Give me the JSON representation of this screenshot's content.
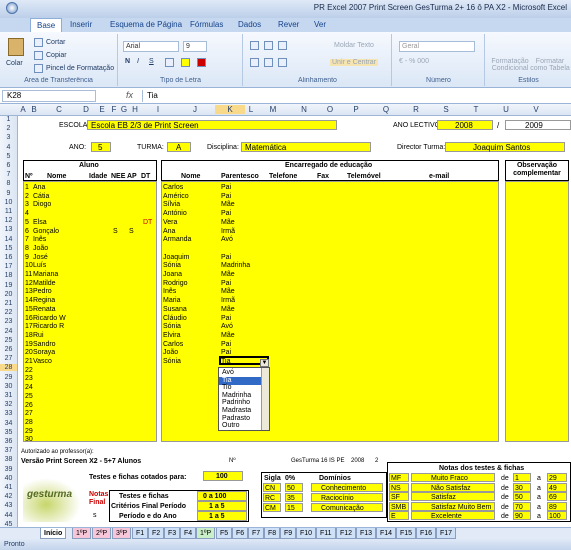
{
  "window": {
    "title": "PR Excel 2007 Print Screen GesTurma 2+ 16 ô PA X2 - Microsoft Excel"
  },
  "tabs": [
    "Base",
    "Inserir",
    "Esquema de Página",
    "Fórmulas",
    "Dados",
    "Rever",
    "Ver"
  ],
  "ribbon": {
    "paste": "Colar",
    "cut": "Cortar",
    "copy": "Copiar",
    "format_painter": "Pincel de Formatação",
    "clipboard_group": "Área de Transferência",
    "font_name": "Arial",
    "font_size": "9",
    "font_group": "Tipo de Letra",
    "wrap_text": "Moldar Texto",
    "merge_center": "Unir e Centrar",
    "alignment_group": "Alinhamento",
    "number_format": "Geral",
    "number_group": "Número",
    "conditional": "Formatação Condicional",
    "as_table": "Formatar como Tabela",
    "styles_group": "Estilos"
  },
  "formula_bar": {
    "cell": "K28",
    "fx": "fx",
    "value": "Tia"
  },
  "columns": [
    "A",
    "B",
    "C",
    "D",
    "E",
    "F",
    "G",
    "H",
    "I",
    "J",
    "K",
    "L",
    "M",
    "N",
    "O",
    "P",
    "Q",
    "R",
    "S",
    "T",
    "U",
    "V",
    "W",
    "X"
  ],
  "rows": [
    "1",
    "2",
    "3",
    "4",
    "5",
    "6",
    "7",
    "8",
    "9",
    "10",
    "11",
    "12",
    "13",
    "14",
    "15",
    "16",
    "17",
    "18",
    "19",
    "20",
    "21",
    "22",
    "23",
    "24",
    "25",
    "26",
    "27",
    "28",
    "29",
    "30",
    "31",
    "32",
    "33",
    "34",
    "35",
    "36",
    "37",
    "38",
    "39",
    "40",
    "41",
    "42",
    "43",
    "44",
    "45"
  ],
  "header": {
    "escola_label": "ESCOLA:",
    "escola_value": "Escola EB 2/3 de Print Screen",
    "ano_lectivo_label": "ANO LECTIVO:",
    "ano1": "2008",
    "slash": "/",
    "ano2": "2009",
    "ano_label": "ANO:",
    "ano_value": "5",
    "turma_label": "TURMA:",
    "turma_value": "A",
    "disciplina_label": "Disciplina:",
    "disciplina_value": "Matemática",
    "director_label": "Director Turma:",
    "director_value": "Joaquim Santos"
  },
  "table_headers": {
    "aluno": "Aluno",
    "enc": "Encarregado de educação",
    "obs": "Observação complementar",
    "n": "Nº",
    "nome": "Nome",
    "idade": "Idade",
    "nee": "NEE",
    "ap": "AP",
    "dt": "DT",
    "enc_nome": "Nome",
    "parentesco": "Parentesco",
    "telefone": "Telefone",
    "fax": "Fax",
    "telemovel": "Telemóvel",
    "email": "e-mail"
  },
  "students": [
    {
      "n": "1",
      "nome": "Ana",
      "nee": "",
      "ap": "",
      "dt": "",
      "enc": "Carlos",
      "par": "Pai"
    },
    {
      "n": "2",
      "nome": "Cátia",
      "nee": "",
      "ap": "",
      "dt": "",
      "enc": "Américo",
      "par": "Pai"
    },
    {
      "n": "3",
      "nome": "Diogo",
      "nee": "",
      "ap": "",
      "dt": "",
      "enc": "Sílvia",
      "par": "Mãe"
    },
    {
      "n": "4",
      "nome": "",
      "nee": "",
      "ap": "",
      "dt": "",
      "enc": "António",
      "par": "Pai"
    },
    {
      "n": "5",
      "nome": "Elsa",
      "nee": "",
      "ap": "",
      "dt": "DT",
      "enc": "Vera",
      "par": "Mãe"
    },
    {
      "n": "6",
      "nome": "Gonçalo",
      "nee": "S",
      "ap": "S",
      "dt": "",
      "enc": "Ana",
      "par": "Irmã"
    },
    {
      "n": "7",
      "nome": "Inês",
      "nee": "",
      "ap": "",
      "dt": "",
      "enc": "Armanda",
      "par": "Avó"
    },
    {
      "n": "8",
      "nome": "João",
      "nee": "",
      "ap": "",
      "dt": "",
      "enc": "",
      "par": ""
    },
    {
      "n": "9",
      "nome": "José",
      "nee": "",
      "ap": "",
      "dt": "",
      "enc": "Joaquim",
      "par": "Pai"
    },
    {
      "n": "10",
      "nome": "Luís",
      "nee": "",
      "ap": "",
      "dt": "",
      "enc": "Sónia",
      "par": "Madrinha"
    },
    {
      "n": "11",
      "nome": "Mariana",
      "nee": "",
      "ap": "",
      "dt": "",
      "enc": "Joana",
      "par": "Mãe"
    },
    {
      "n": "12",
      "nome": "Matilde",
      "nee": "",
      "ap": "",
      "dt": "",
      "enc": "Rodrigo",
      "par": "Pai"
    },
    {
      "n": "13",
      "nome": "Pedro",
      "nee": "",
      "ap": "",
      "dt": "",
      "enc": "Inês",
      "par": "Mãe"
    },
    {
      "n": "14",
      "nome": "Regina",
      "nee": "",
      "ap": "",
      "dt": "",
      "enc": "Maria",
      "par": "Irmã"
    },
    {
      "n": "15",
      "nome": "Renata",
      "nee": "",
      "ap": "",
      "dt": "",
      "enc": "Susana",
      "par": "Mãe"
    },
    {
      "n": "16",
      "nome": "Ricardo W",
      "nee": "",
      "ap": "",
      "dt": "",
      "enc": "Cláudio",
      "par": "Pai"
    },
    {
      "n": "17",
      "nome": "Ricardo R",
      "nee": "",
      "ap": "",
      "dt": "",
      "enc": "Sónia",
      "par": "Avó"
    },
    {
      "n": "18",
      "nome": "Rui",
      "nee": "",
      "ap": "",
      "dt": "",
      "enc": "Elvira",
      "par": "Mãe"
    },
    {
      "n": "19",
      "nome": "Sandro",
      "nee": "",
      "ap": "",
      "dt": "",
      "enc": "Carlos",
      "par": "Pai"
    },
    {
      "n": "20",
      "nome": "Soraya",
      "nee": "",
      "ap": "",
      "dt": "",
      "enc": "João",
      "par": "Pai"
    },
    {
      "n": "21",
      "nome": "Vasco",
      "nee": "",
      "ap": "",
      "dt": "",
      "enc": "Sónia",
      "par": "Tia"
    },
    {
      "n": "22",
      "nome": "",
      "nee": "",
      "ap": "",
      "dt": "",
      "enc": "",
      "par": ""
    },
    {
      "n": "23",
      "nome": "",
      "nee": "",
      "ap": "",
      "dt": "",
      "enc": "",
      "par": ""
    },
    {
      "n": "24",
      "nome": "",
      "nee": "",
      "ap": "",
      "dt": "",
      "enc": "",
      "par": ""
    },
    {
      "n": "25",
      "nome": "",
      "nee": "",
      "ap": "",
      "dt": "",
      "enc": "",
      "par": ""
    },
    {
      "n": "26",
      "nome": "",
      "nee": "",
      "ap": "",
      "dt": "",
      "enc": "",
      "par": ""
    },
    {
      "n": "27",
      "nome": "",
      "nee": "",
      "ap": "",
      "dt": "",
      "enc": "",
      "par": ""
    },
    {
      "n": "28",
      "nome": "",
      "nee": "",
      "ap": "",
      "dt": "",
      "enc": "",
      "par": ""
    },
    {
      "n": "29",
      "nome": "",
      "nee": "",
      "ap": "",
      "dt": "",
      "enc": "",
      "par": ""
    },
    {
      "n": "30",
      "nome": "",
      "nee": "",
      "ap": "",
      "dt": "",
      "enc": "",
      "par": ""
    }
  ],
  "dropdown": [
    "Avó",
    "Tia",
    "Tio",
    "Madrinha",
    "Padrinho",
    "Madrasta",
    "Padrasto",
    "Outro"
  ],
  "footer": {
    "autorizado": "Autorizado ao professor(a):",
    "versao": "Versão Print Screen X2 - 5+7 Alunos",
    "nr": "Nº",
    "gesturma_pe": "GesTurma 16 IS PE",
    "ano_small": "2008",
    "dois": "2",
    "testes_label": "Testes e fichas cotados para:",
    "testes_value": "100",
    "notas_final": "Notas Final",
    "s": "s",
    "tf_label": "Testes e fichas",
    "tf_value": "0 a 100",
    "cfp_label": "Critérios Final Período",
    "cfp_value": "1 a 5",
    "pa_label": "Período e do Ano",
    "pa_value": "1 a 5",
    "logo_text": "gesturma",
    "sigla": "Sigla",
    "pct": "0%",
    "dominios": "Domínios",
    "dom": [
      {
        "s": "CN",
        "p": "50",
        "d": "Conhecimento"
      },
      {
        "s": "RC",
        "p": "35",
        "d": "Raciocínio"
      },
      {
        "s": "CM",
        "p": "15",
        "d": "Comunicação"
      }
    ],
    "notas_title": "Notas dos testes & fichas",
    "notas": [
      {
        "s": "MF",
        "d": "Muito Fraco",
        "de": "de",
        "a1": "1",
        "a": "a",
        "a2": "29"
      },
      {
        "s": "NS",
        "d": "Não Satisfaz",
        "de": "de",
        "a1": "30",
        "a": "a",
        "a2": "49"
      },
      {
        "s": "SF",
        "d": "Satisfaz",
        "de": "de",
        "a1": "50",
        "a": "a",
        "a2": "69"
      },
      {
        "s": "SMB",
        "d": "Satisfaz Muito Bem",
        "de": "de",
        "a1": "70",
        "a": "a",
        "a2": "89"
      },
      {
        "s": "E",
        "d": "Excelente",
        "de": "de",
        "a1": "90",
        "a": "a",
        "a2": "100"
      }
    ]
  },
  "sheets": [
    "Início",
    "1ºP",
    "2ºP",
    "3ºP",
    "F1",
    "F2",
    "F3",
    "F4",
    "1ºP",
    "F5",
    "F6",
    "F7",
    "F8",
    "F9",
    "F10",
    "F11",
    "F12",
    "F13",
    "F14",
    "F15",
    "F16",
    "F17"
  ],
  "status": "Pronto",
  "colors": {
    "yellow": "#ffff00",
    "ribbon": "#dbe7f6",
    "selection": "#3169c6"
  }
}
